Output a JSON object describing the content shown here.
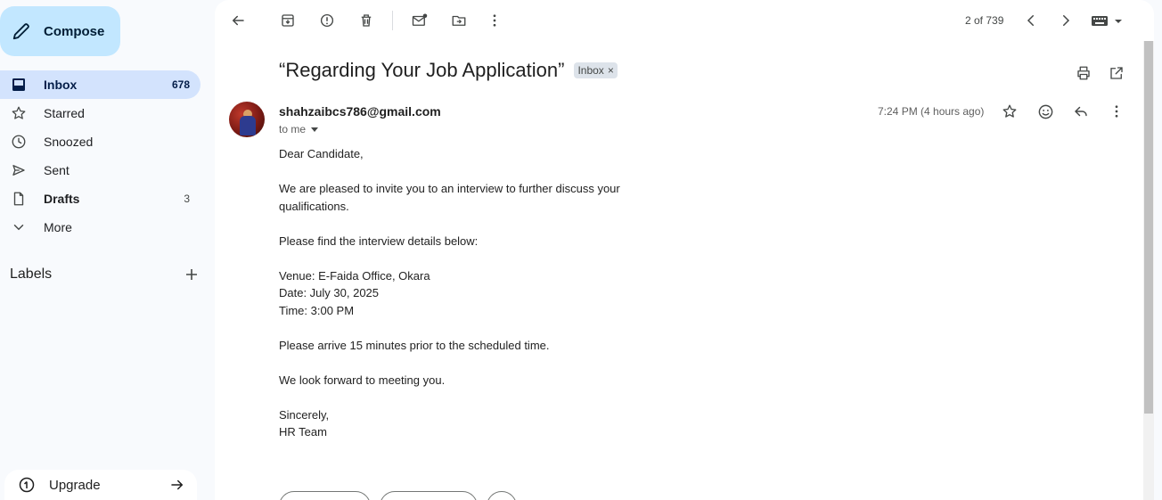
{
  "sidebar": {
    "compose_label": "Compose",
    "items": [
      {
        "label": "Inbox",
        "count": "678"
      },
      {
        "label": "Starred",
        "count": ""
      },
      {
        "label": "Snoozed",
        "count": ""
      },
      {
        "label": "Sent",
        "count": ""
      },
      {
        "label": "Drafts",
        "count": "3"
      },
      {
        "label": "More",
        "count": ""
      }
    ],
    "labels_title": "Labels",
    "upgrade_label": "Upgrade"
  },
  "toolbar": {
    "page_count": "2 of 739"
  },
  "email": {
    "subject": "“Regarding Your Job Application”",
    "chip_label": "Inbox",
    "chip_close": "×",
    "sender": "shahzaibcs786@gmail.com",
    "to": "to me",
    "time": "7:24 PM (4 hours ago)",
    "body": [
      "Dear Candidate,",
      "",
      "We are pleased to invite you to an interview to further discuss your qualifications.",
      "",
      "Please find the interview details below:",
      "",
      "Venue: E-Faida Office, Okara",
      "Date: July 30, 2025",
      "Time: 3:00 PM",
      "",
      "Please arrive 15 minutes prior to the scheduled time.",
      "",
      "We look forward to meeting you.",
      "",
      "Sincerely,",
      "HR Team"
    ]
  },
  "colors": {
    "compose_bg": "#c2e7ff",
    "active_nav_bg": "#d3e3fd",
    "page_bg": "#f8fafd",
    "panel_bg": "#ffffff"
  },
  "icons": [
    "pencil-icon",
    "inbox-icon",
    "star-icon",
    "clock-icon",
    "send-icon",
    "file-icon",
    "chevron-down-icon",
    "plus-icon",
    "upgrade-icon",
    "arrow-right-icon",
    "back-arrow-icon",
    "archive-icon",
    "report-spam-icon",
    "delete-icon",
    "mark-unread-icon",
    "move-to-icon",
    "more-vert-icon",
    "chevron-left-icon",
    "chevron-right-icon",
    "keyboard-icon",
    "print-icon",
    "open-new-window-icon",
    "emoji-icon",
    "reply-icon"
  ]
}
